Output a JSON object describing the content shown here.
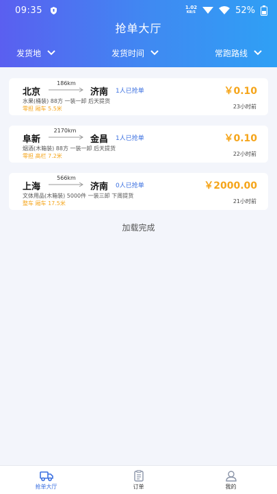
{
  "status_bar": {
    "time": "09:35",
    "net_speed_value": "1.02",
    "net_speed_unit": "KB/S",
    "battery": "52%"
  },
  "header": {
    "title": "抢单大厅",
    "filters": [
      {
        "label": "发货地"
      },
      {
        "label": "发货时间"
      },
      {
        "label": "常跑路线"
      }
    ]
  },
  "orders": [
    {
      "from": "北京",
      "to": "济南",
      "distance": "186km",
      "grabbed": "1人已抢单",
      "price": "￥0.10",
      "cargo": "水果(桶装) 88方 一装一卸 后天提货",
      "vehicle": "零担 厢车 5.5米",
      "ago": "23小时前"
    },
    {
      "from": "阜新",
      "to": "金昌",
      "distance": "2170km",
      "grabbed": "1人已抢单",
      "price": "￥0.10",
      "cargo": "烟酒(木箱装) 88方 一装一卸 后天提货",
      "vehicle": "零担 高栏 7.2米",
      "ago": "22小时前"
    },
    {
      "from": "上海",
      "to": "济南",
      "distance": "566km",
      "grabbed": "0人已抢单",
      "price": "￥2000.00",
      "cargo": "文体用品(木箱装) 5000件 一装三卸 下周提货",
      "vehicle": "整车 厢车 17.5米",
      "ago": "21小时前"
    }
  ],
  "list_footer": "加载完成",
  "tabbar": [
    {
      "label": "抢单大厅",
      "icon": "truck-icon",
      "active": true
    },
    {
      "label": "订单",
      "icon": "clipboard-icon",
      "active": false
    },
    {
      "label": "我的",
      "icon": "user-icon",
      "active": false
    }
  ],
  "colors": {
    "accent": "#3a6fe0",
    "price": "#f5a51b",
    "header_gradient_start": "#5a5ff0",
    "header_gradient_end": "#2fa0f5"
  }
}
